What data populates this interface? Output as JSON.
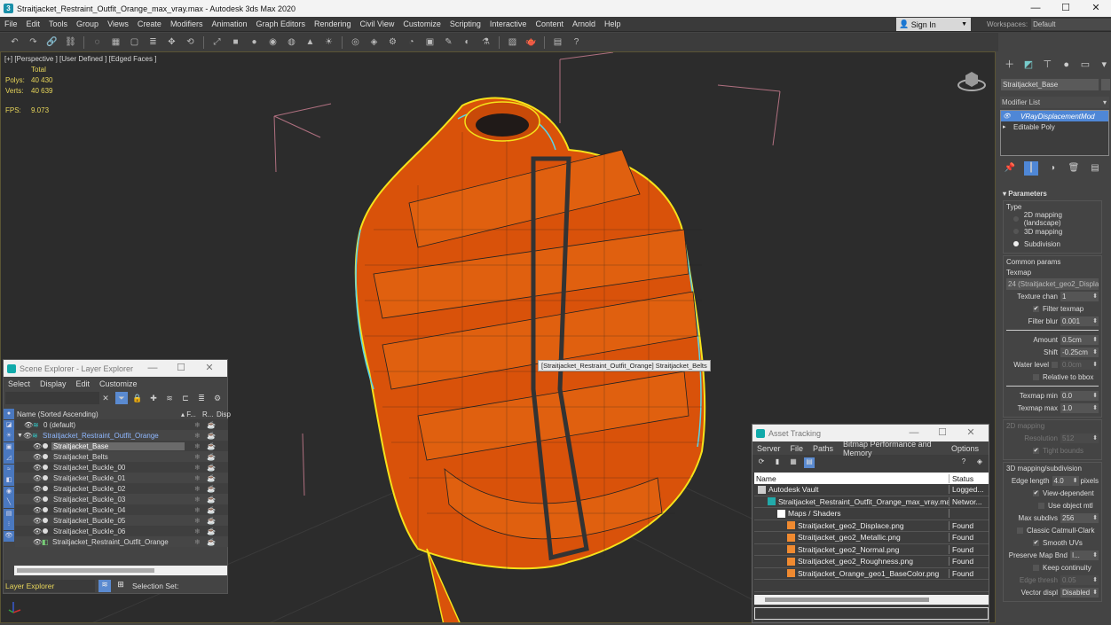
{
  "window": {
    "title": "Straitjacket_Restraint_Outfit_Orange_max_vray.max - Autodesk 3ds Max 2020",
    "app_icon": "3ds-max-icon",
    "controls": [
      "minimize",
      "maximize",
      "close"
    ]
  },
  "menu": [
    "File",
    "Edit",
    "Tools",
    "Group",
    "Views",
    "Create",
    "Modifiers",
    "Animation",
    "Graph Editors",
    "Rendering",
    "Civil View",
    "Customize",
    "Scripting",
    "Interactive",
    "Content",
    "Arnold",
    "Help"
  ],
  "account": {
    "sign_in": "Sign In",
    "workspaces_label": "Workspaces:",
    "workspace": "Default"
  },
  "toolbar_icons": [
    "undo-icon",
    "redo-icon",
    "link-icon",
    "unlink-icon",
    "bind-space-warp-icon",
    "selection-filter-icon",
    "select-object-icon",
    "select-by-name-icon",
    "select-move-icon",
    "select-rotate-icon",
    "select-scale-icon",
    "create-box-icon",
    "create-sphere-icon",
    "create-cylinder-icon",
    "create-torus-icon",
    "create-cone-icon",
    "create-light-icon",
    "create-camera-icon",
    "modifier-icon",
    "hierarchy-icon",
    "motion-icon",
    "display-icon",
    "utilities-icon",
    "material-editor-icon",
    "render-setup-icon",
    "render-frame-icon",
    "render-icon",
    "viewport-layout-icon",
    "help-icon"
  ],
  "viewport": {
    "label": "[+] [Perspective ] [User Defined ] [Edged Faces ]",
    "stats": {
      "header": "Total",
      "polys_label": "Polys:",
      "polys": "40 430",
      "verts_label": "Verts:",
      "verts": "40 639",
      "fps_label": "FPS:",
      "fps": "9.073"
    },
    "tooltip": "[Straitjacket_Restraint_Outfit_Orange] Straitjacket_Belts",
    "object_color": "#e8580c",
    "selection_color": "#f5e21a",
    "highlight_color": "#59d4e8"
  },
  "scene_explorer": {
    "title": "Scene Explorer - Layer Explorer",
    "menu": [
      "Select",
      "Display",
      "Edit",
      "Customize"
    ],
    "columns": {
      "name": "Name (Sorted Ascending)",
      "frozen": "▴ F...",
      "render": "R...",
      "display": "Disp"
    },
    "rows": [
      {
        "name": "0 (default)",
        "type": "layer",
        "indent": 1
      },
      {
        "name": "Straitjacket_Restraint_Outfit_Orange",
        "type": "layer",
        "indent": 0,
        "expanded": true,
        "highlighted": true
      },
      {
        "name": "Straitjacket_Base",
        "type": "object",
        "indent": 2,
        "selected": true
      },
      {
        "name": "Straitjacket_Belts",
        "type": "object",
        "indent": 2
      },
      {
        "name": "Straitjacket_Buckle_00",
        "type": "object",
        "indent": 2
      },
      {
        "name": "Straitjacket_Buckle_01",
        "type": "object",
        "indent": 2
      },
      {
        "name": "Straitjacket_Buckle_02",
        "type": "object",
        "indent": 2
      },
      {
        "name": "Straitjacket_Buckle_03",
        "type": "object",
        "indent": 2
      },
      {
        "name": "Straitjacket_Buckle_04",
        "type": "object",
        "indent": 2
      },
      {
        "name": "Straitjacket_Buckle_05",
        "type": "object",
        "indent": 2
      },
      {
        "name": "Straitjacket_Buckle_06",
        "type": "object",
        "indent": 2
      },
      {
        "name": "Straitjacket_Restraint_Outfit_Orange",
        "type": "group",
        "indent": 2
      }
    ],
    "footer": {
      "explorer": "Layer Explorer",
      "selection_set": "Selection Set:"
    }
  },
  "asset_tracking": {
    "title": "Asset Tracking",
    "menu": [
      "Server",
      "File",
      "Paths",
      "Bitmap Performance and Memory",
      "Options"
    ],
    "columns": {
      "name": "Name",
      "status": "Status"
    },
    "rows": [
      {
        "name": "Autodesk Vault",
        "status": "Logged...",
        "icon": "vault-icon",
        "indent": 0
      },
      {
        "name": "Straitjacket_Restraint_Outfit_Orange_max_vray.max",
        "status": "Networ...",
        "icon": "max-file-icon",
        "indent": 1
      },
      {
        "name": "Maps / Shaders",
        "status": "",
        "icon": "maps-icon",
        "indent": 2
      },
      {
        "name": "Straitjacket_geo2_Displace.png",
        "status": "Found",
        "icon": "bitmap-icon",
        "indent": 3
      },
      {
        "name": "Straitjacket_geo2_Metallic.png",
        "status": "Found",
        "icon": "bitmap-icon",
        "indent": 3
      },
      {
        "name": "Straitjacket_geo2_Normal.png",
        "status": "Found",
        "icon": "bitmap-icon",
        "indent": 3
      },
      {
        "name": "Straitjacket_geo2_Roughness.png",
        "status": "Found",
        "icon": "bitmap-icon",
        "indent": 3
      },
      {
        "name": "Straitjacket_Orange_geo1_BaseColor.png",
        "status": "Found",
        "icon": "bitmap-icon",
        "indent": 3
      }
    ]
  },
  "command_panel": {
    "object_name": "Straitjacket_Base",
    "modifier_list": "Modifier List",
    "stack": [
      {
        "name": "VRayDisplacementMod",
        "selected": true
      },
      {
        "name": "Editable Poly",
        "selected": false
      }
    ],
    "parameters": {
      "title": "Parameters",
      "type_label": "Type",
      "type_options": [
        {
          "label": "2D mapping (landscape)",
          "checked": false
        },
        {
          "label": "3D mapping",
          "checked": false
        },
        {
          "label": "Subdivision",
          "checked": true
        }
      ],
      "common_params": "Common params",
      "texmap_label": "Texmap",
      "texmap": "24 (Straitjacket_geo2_Displac",
      "texture_chan_label": "Texture chan",
      "texture_chan": "1",
      "filter_texmap": "Filter texmap",
      "filter_texmap_checked": true,
      "filter_blur_label": "Filter blur",
      "filter_blur": "0.001",
      "amount_label": "Amount",
      "amount": "0.5cm",
      "shift_label": "Shift",
      "shift": "-0.25cm",
      "water_level_label": "Water level",
      "water_level": "0.0cm",
      "relative_to_bbox": "Relative to bbox",
      "texmap_min_label": "Texmap min",
      "texmap_min": "0.0",
      "texmap_max_label": "Texmap max",
      "texmap_max": "1.0",
      "mapping2d": "2D mapping",
      "resolution_label": "Resolution",
      "resolution": "512",
      "tight_bounds": "Tight bounds",
      "mapping3d": "3D mapping/subdivision",
      "edge_length_label": "Edge length",
      "edge_length": "4.0",
      "edge_length_unit": "pixels",
      "view_dependent": "View-dependent",
      "use_object_mtl": "Use object mtl",
      "max_subdivs_label": "Max subdivs",
      "max_subdivs": "256",
      "classic_catmull": "Classic Catmull-Clark",
      "smooth_uvs": "Smooth UVs",
      "preserve_map_bnd_label": "Preserve Map Bnd",
      "preserve_map_bnd": "I...",
      "keep_continuity": "Keep continuity",
      "edge_thresh_label": "Edge thresh",
      "edge_thresh": "0.05",
      "vector_displ_label": "Vector displ",
      "vector_displ": "Disabled"
    }
  }
}
